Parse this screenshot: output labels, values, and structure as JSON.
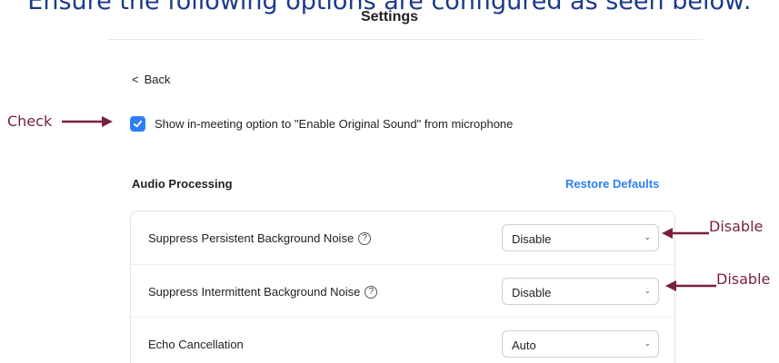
{
  "banner_title": "Ensure the following options are configured as seen below:",
  "page_title": "Settings",
  "back_label": "Back",
  "original_sound_option": {
    "label": "Show in-meeting option to \"Enable Original Sound\" from microphone",
    "checked": true
  },
  "audio_processing": {
    "section_title": "Audio Processing",
    "restore_label": "Restore Defaults",
    "rows": [
      {
        "label": "Suppress Persistent Background Noise",
        "help": "?",
        "value": "Disable"
      },
      {
        "label": "Suppress Intermittent Background Noise",
        "help": "?",
        "value": "Disable"
      },
      {
        "label": "Echo Cancellation",
        "value": "Auto"
      }
    ]
  },
  "annotations": {
    "check": "Check",
    "disable_1": "Disable",
    "disable_2": "Disable"
  },
  "colors": {
    "accent": "#2d7ff9",
    "annotation": "#7a1f3d"
  }
}
